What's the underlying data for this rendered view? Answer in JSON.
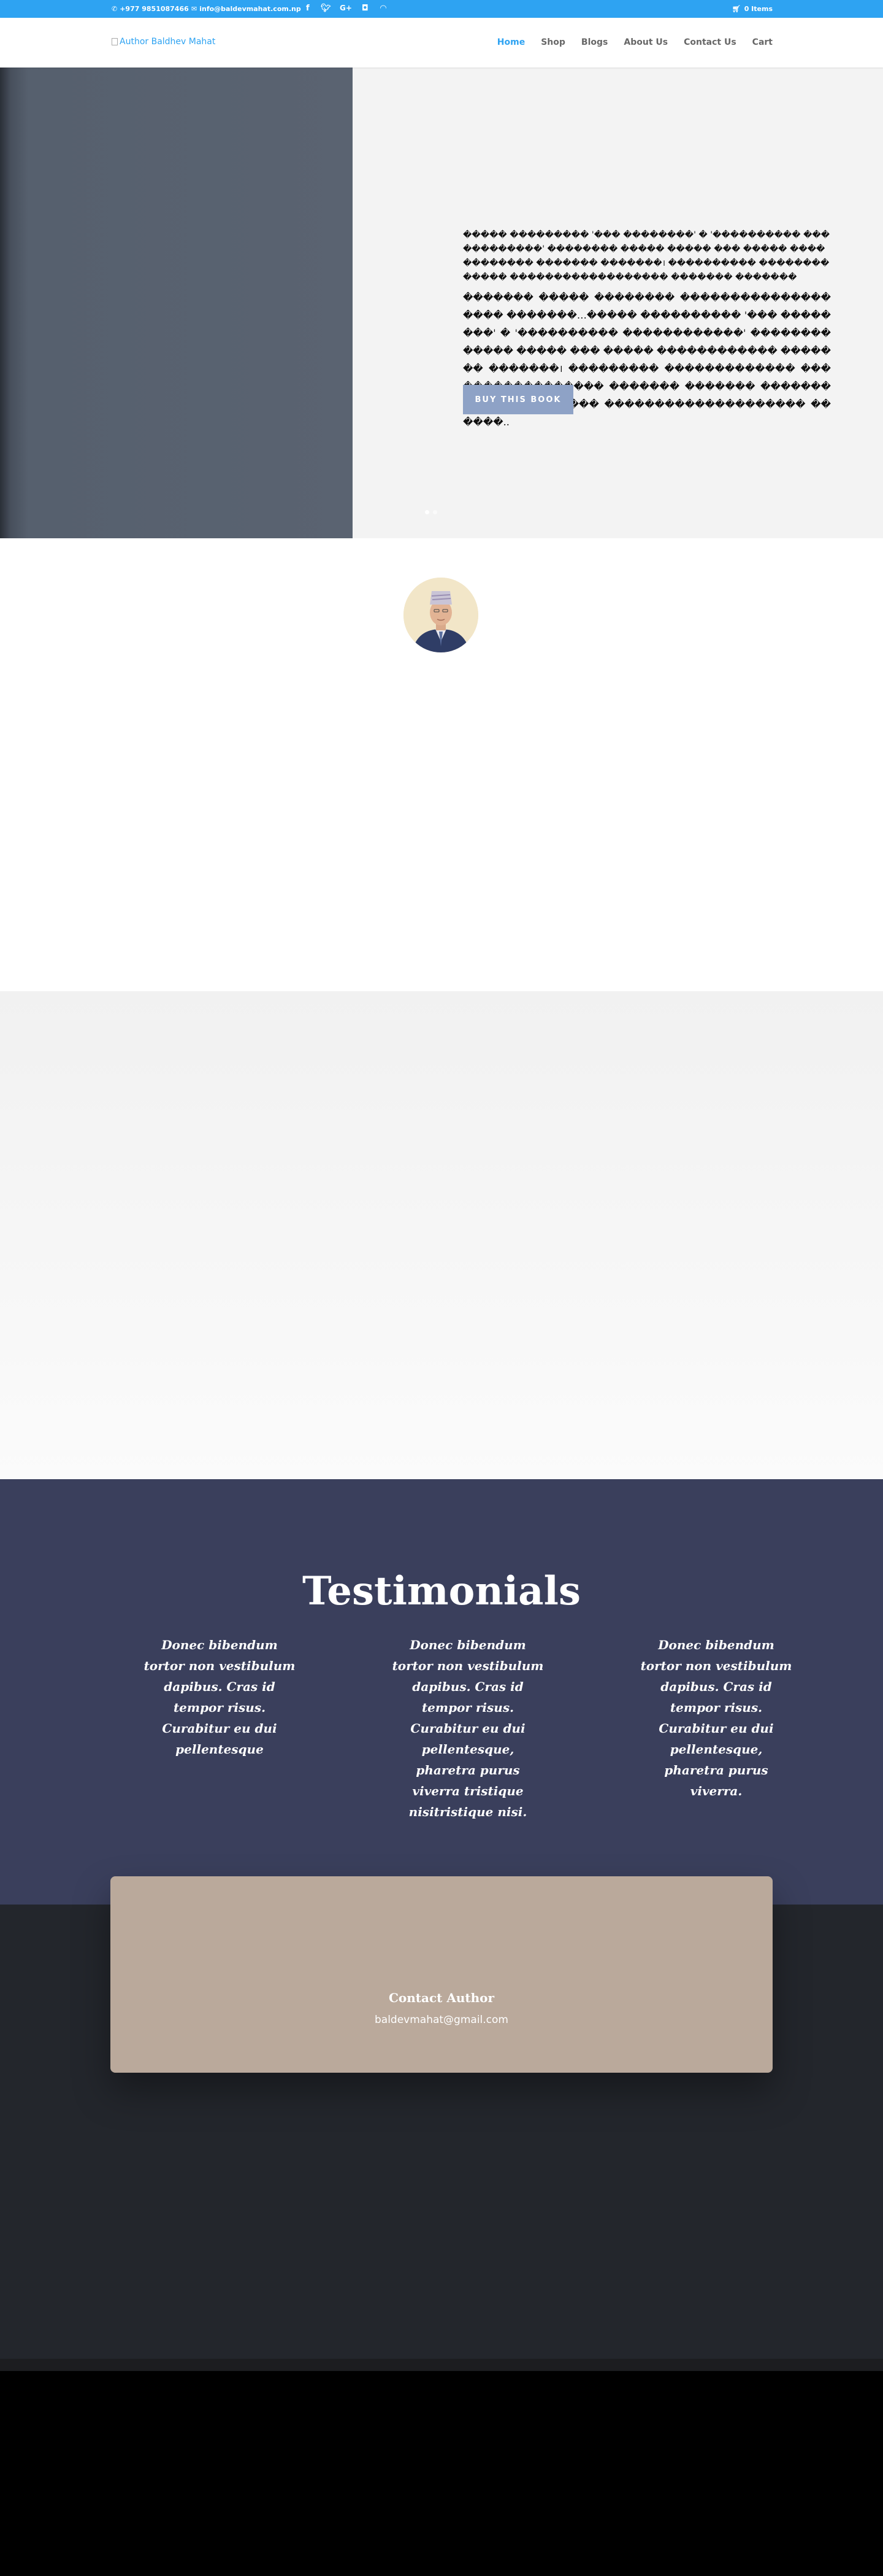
{
  "topbar": {
    "phone": "+977 9851087466",
    "email": "info@baldevmahat.com.np",
    "cart": "0 Items",
    "social": [
      "facebook-icon",
      "twitter-icon",
      "google-plus-icon",
      "instagram-icon",
      "rss-icon"
    ]
  },
  "header": {
    "logo_alt": "Author Baldhev Mahat",
    "nav": [
      "Home",
      "Shop",
      "Blogs",
      "About Us",
      "Contact Us",
      "Cart"
    ],
    "active": "Home"
  },
  "hero": {
    "text_1": "����� ��������� '��� ��������' � '���������� ������������' �������� ����� ����� ��� ����� ������������ ������� �������। ���������� ������������� ������������������ ������� �������",
    "text_2": "������� ����� �������� ������������������� �������…����� ���������� '��� ��������' � '���������� ������������' �������� ����� ����� ��� ����� ������������ ������� �������। ��������� ������������� ����������������� ������� ������� ������� ����� �������� �������������������� ������..",
    "button": "BUY THIS BOOK",
    "slides": 2,
    "active_slide": 1
  },
  "about": {
    "avatar": "author-portrait"
  },
  "testimonials": {
    "title": "Testimonials",
    "quotes": [
      "Donec bibendum tortor non vestibulum dapibus. Cras id tempor risus. Curabitur eu dui pellentesque",
      "Donec bibendum tortor non vestibulum dapibus. Cras id tempor risus. Curabitur eu dui pellentesque, pharetra purus viverra tristique nisitristique nisi.",
      "Donec bibendum tortor non vestibulum dapibus. Cras id tempor risus. Curabitur eu dui pellentesque, pharetra purus viverra."
    ]
  },
  "contact": {
    "title": "Contact Author",
    "email": "baldevmahat@gmail.com"
  },
  "colors": {
    "accent": "#2ea3f2",
    "button": "#8ea2c6",
    "testimonials_bg": "#3a3f5c",
    "contact_card": "#baa99b"
  }
}
